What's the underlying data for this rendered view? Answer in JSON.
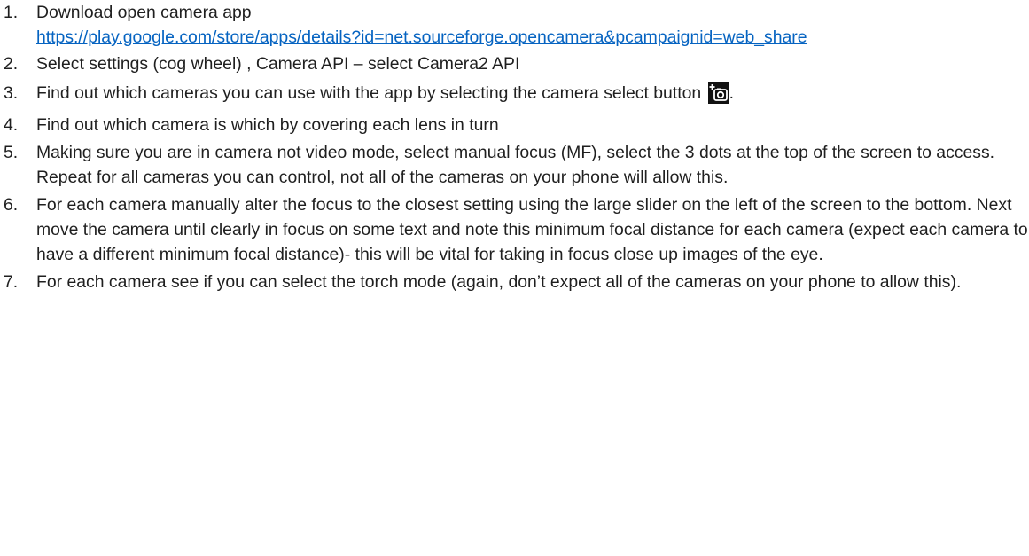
{
  "steps": [
    {
      "number": "1.",
      "text": "Download open camera app",
      "link": "https://play.google.com/store/apps/details?id=net.sourceforge.opencamera&pcampaignid=web_share"
    },
    {
      "number": "2.",
      "text": "Select settings (cog wheel) , Camera API – select Camera2 API"
    },
    {
      "number": "3.",
      "text": "Find out which cameras you can use with the app by selecting the camera select button",
      "suffix": ".",
      "icon": "camera-switch-icon"
    },
    {
      "number": "4.",
      "text": "Find out which camera is which by covering each lens in turn"
    },
    {
      "number": "5.",
      "text": "Making sure you are in camera not video mode, select manual focus (MF), select the 3 dots at the top of the screen to access. Repeat for all cameras you can control, not all of the cameras on your phone will allow this."
    },
    {
      "number": "6.",
      "text": "For each camera manually alter the focus to the closest setting using the large slider on the left of the screen to the bottom. Next move the camera until clearly in focus on some text and note this minimum focal distance for each camera (expect each camera to have a different minimum focal distance)- this will be vital for taking in focus close up images of the eye."
    },
    {
      "number": "7.",
      "text": "For each camera see if you can select the torch mode (again, don’t expect all of the cameras on your phone to allow this)."
    }
  ]
}
